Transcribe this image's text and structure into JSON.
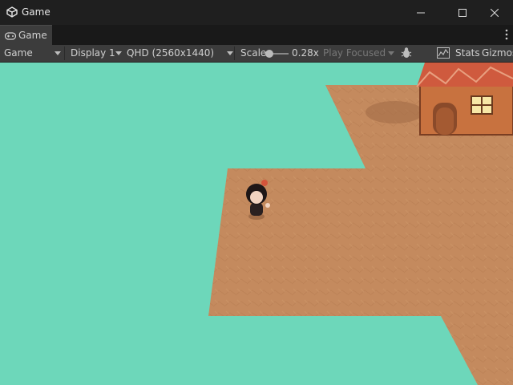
{
  "window": {
    "title": "Game",
    "app_icon": "unity-logo-icon",
    "controls": [
      "minimize-icon",
      "maximize-icon",
      "close-icon"
    ]
  },
  "tab": {
    "label": "Game",
    "icon": "gamepad-icon"
  },
  "toolbar": {
    "view_mode": "Game",
    "display": "Display 1",
    "resolution": "QHD (2560x1440)",
    "scale_label": "Scale",
    "scale_value": "0.28x",
    "play_mode": "Play Focused",
    "stats_label": "Stats",
    "gizmos_label": "Gizmos"
  },
  "viewport": {
    "background_color": "#6dd7ba",
    "ground_color": "#c48a5e",
    "roof_color": "#cf5a3e",
    "scene_objects": [
      "dirt-ground",
      "house",
      "player-character"
    ]
  }
}
